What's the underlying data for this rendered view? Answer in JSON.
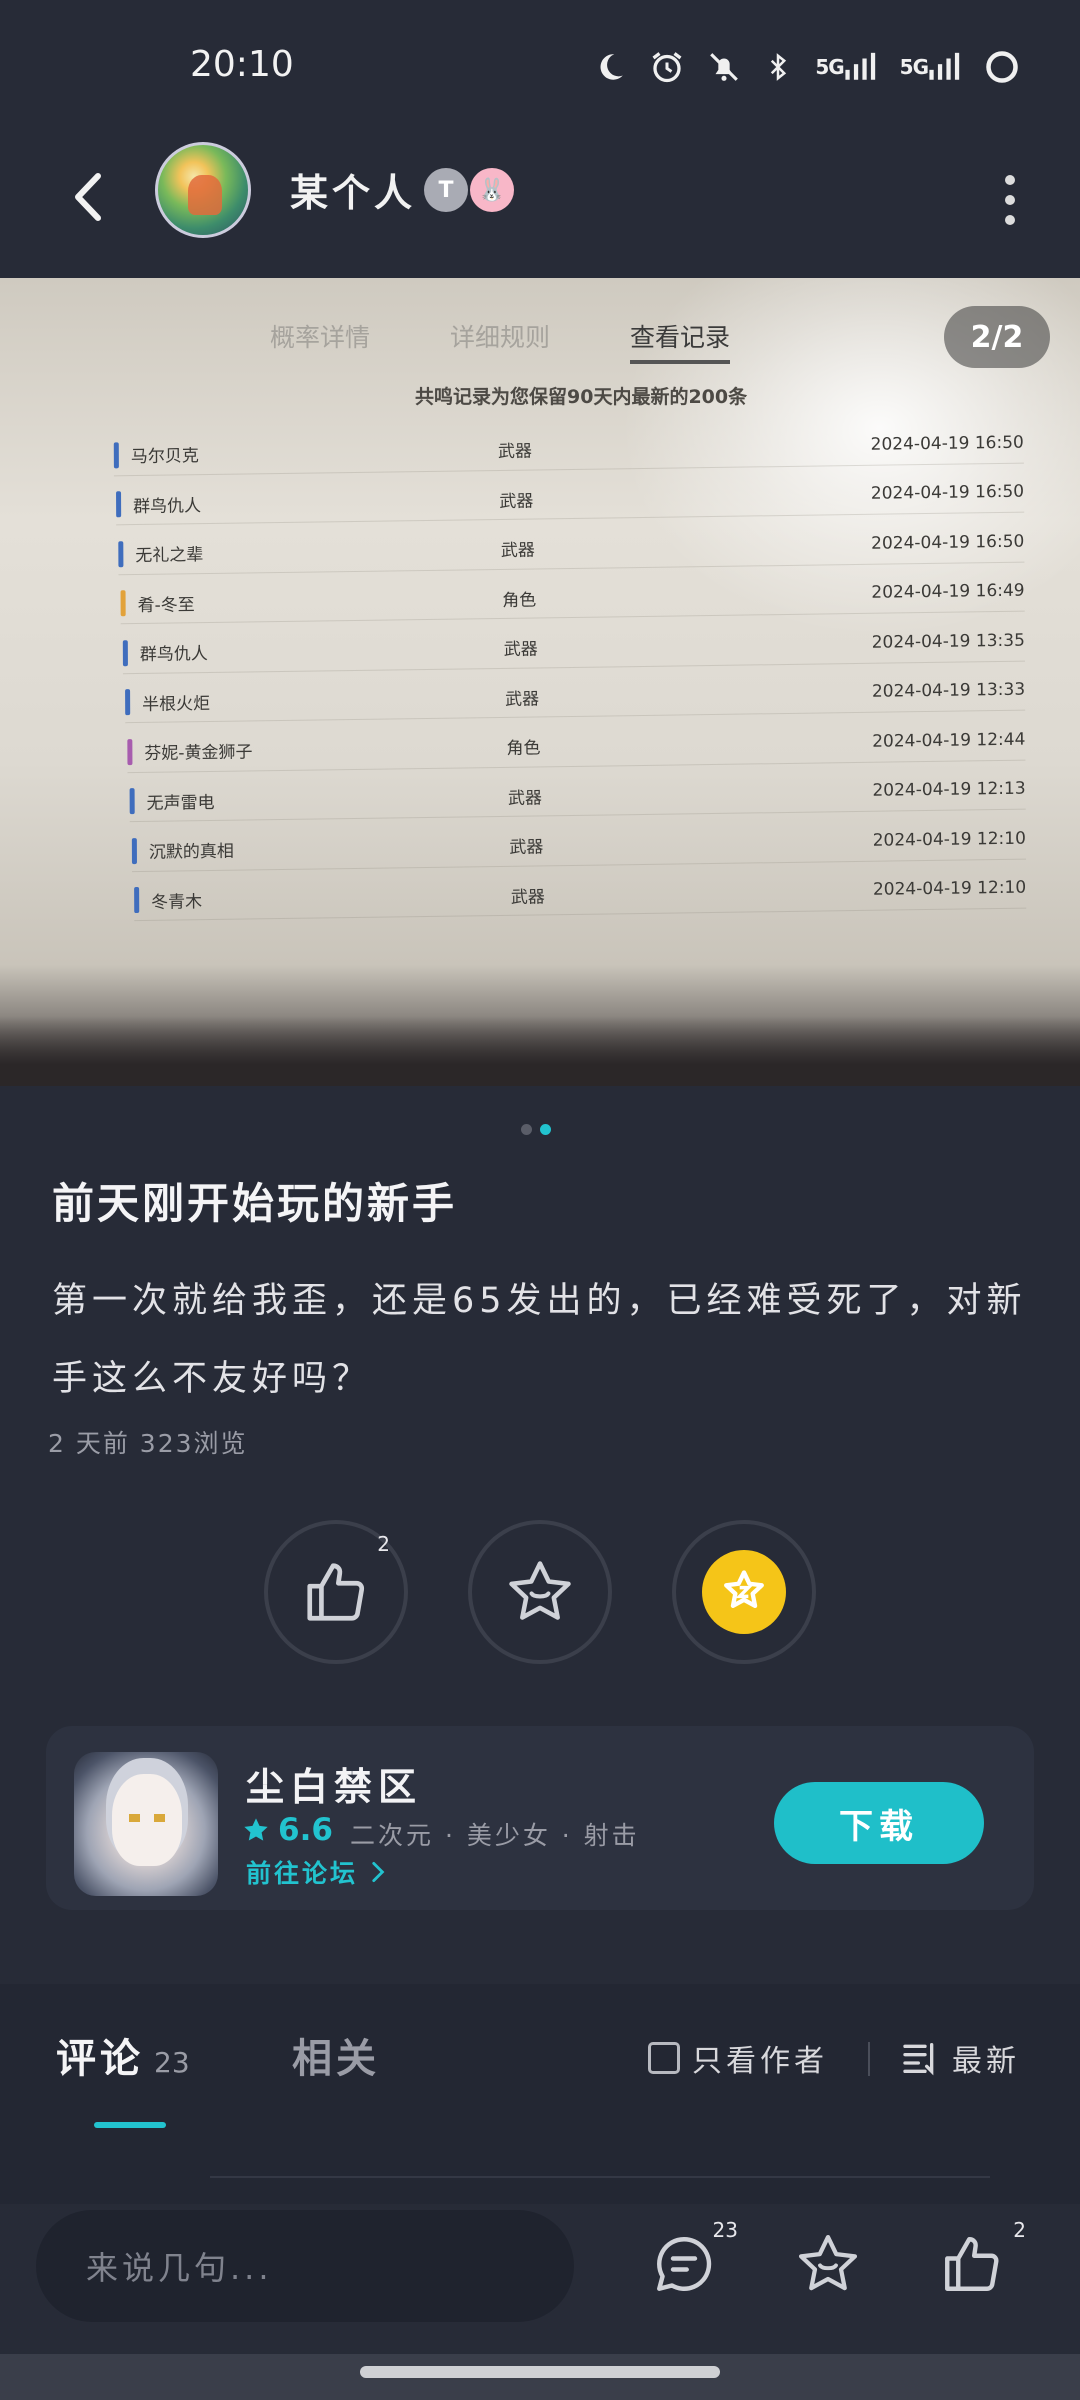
{
  "status_bar": {
    "time": "20:10",
    "icons": [
      "moon-icon",
      "alarm-icon",
      "mute-icon",
      "bluetooth-icon",
      "signal-5g-icon",
      "signal-5g-icon",
      "battery-ring-icon"
    ],
    "net1": "5G",
    "net2": "5G"
  },
  "header": {
    "username": "某个人",
    "badge1": "T",
    "badge2": "🐰"
  },
  "photo": {
    "tabs": [
      "概率详情",
      "详细规则",
      "查看记录"
    ],
    "active_tab": "查看记录",
    "page_indicator": "2/2",
    "subtitle": "共鸣记录为您保留90天内最新的200条",
    "records": [
      {
        "name": "马尔贝克",
        "type": "武器",
        "datetime": "2024-04-19 16:50",
        "color": "#3f6dbd"
      },
      {
        "name": "群鸟仇人",
        "type": "武器",
        "datetime": "2024-04-19 16:50",
        "color": "#3f6dbd"
      },
      {
        "name": "无礼之辈",
        "type": "武器",
        "datetime": "2024-04-19 16:50",
        "color": "#3f6dbd"
      },
      {
        "name": "肴-冬至",
        "type": "角色",
        "datetime": "2024-04-19 16:49",
        "color": "#e2a23a"
      },
      {
        "name": "群鸟仇人",
        "type": "武器",
        "datetime": "2024-04-19 13:35",
        "color": "#3f6dbd"
      },
      {
        "name": "半根火炬",
        "type": "武器",
        "datetime": "2024-04-19 13:33",
        "color": "#3f6dbd"
      },
      {
        "name": "芬妮-黄金狮子",
        "type": "角色",
        "datetime": "2024-04-19 12:44",
        "color": "#a75cae"
      },
      {
        "name": "无声雷电",
        "type": "武器",
        "datetime": "2024-04-19 12:13",
        "color": "#3f6dbd"
      },
      {
        "name": "沉默的真相",
        "type": "武器",
        "datetime": "2024-04-19 12:10",
        "color": "#3f6dbd"
      },
      {
        "name": "冬青木",
        "type": "武器",
        "datetime": "2024-04-19 12:10",
        "color": "#3f6dbd"
      }
    ]
  },
  "post": {
    "title": "前天刚开始玩的新手",
    "body": "第一次就给我歪，还是65发出的，已经难受死了，对新手这么不友好吗？",
    "meta": "2 天前  323浏览",
    "like_count": "2"
  },
  "game": {
    "name": "尘白禁区",
    "rating": "6.6",
    "tags": "二次元 · 美少女 · 射击",
    "forum_link": "前往论坛",
    "download_label": "下载"
  },
  "comments": {
    "tab_comments": "评论",
    "comment_count": "23",
    "tab_related": "相关",
    "author_only": "只看作者",
    "sort_label": "最新"
  },
  "bottom_bar": {
    "input_placeholder": "来说几句...",
    "comment_count": "23",
    "like_count": "2"
  },
  "colors": {
    "accent": "#22c3cf",
    "background": "#272b37",
    "coin": "#f5c518"
  }
}
